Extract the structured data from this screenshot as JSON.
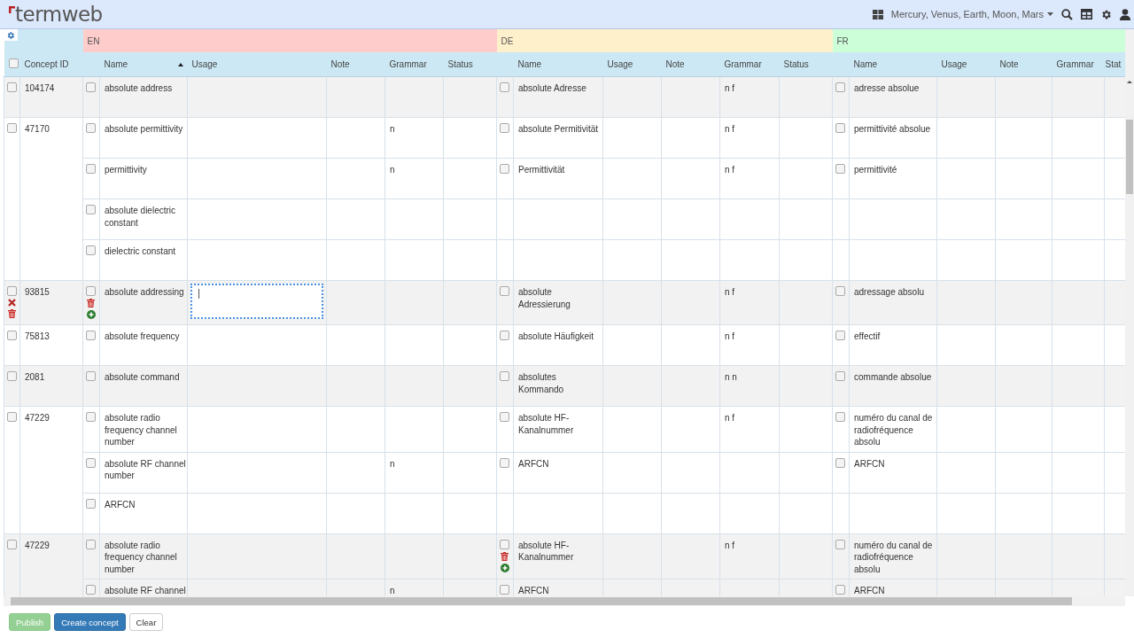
{
  "header": {
    "logo": "termweb",
    "project_selector": "Mercury, Venus, Earth, Moon, Mars"
  },
  "table": {
    "select_all": {
      "checked": false
    },
    "concept_column": "Concept ID",
    "languages": [
      {
        "code": "EN",
        "color": "#ffcccc",
        "columns": [
          {
            "label": "Name",
            "sorted": true
          },
          {
            "label": "Usage",
            "sorted": false
          },
          {
            "label": "Note",
            "sorted": false
          },
          {
            "label": "Grammar",
            "sorted": false
          },
          {
            "label": "Status",
            "sorted": false
          }
        ]
      },
      {
        "code": "DE",
        "color": "#fff0cc",
        "columns": [
          {
            "label": "Name",
            "sorted": false
          },
          {
            "label": "Usage",
            "sorted": false
          },
          {
            "label": "Note",
            "sorted": false
          },
          {
            "label": "Grammar",
            "sorted": false
          },
          {
            "label": "Status",
            "sorted": false
          }
        ]
      },
      {
        "code": "FR",
        "color": "#ccffd8",
        "columns": [
          {
            "label": "Name",
            "sorted": false
          },
          {
            "label": "Usage",
            "sorted": false
          },
          {
            "label": "Note",
            "sorted": false
          },
          {
            "label": "Grammar",
            "sorted": false
          },
          {
            "label": "Stat",
            "sorted": false
          }
        ]
      }
    ],
    "concepts": [
      {
        "id": "104174",
        "checked": false,
        "terms": [
          {
            "en": {
              "name": "absolute address",
              "checked": false
            },
            "de": {
              "name": "absolute Adresse",
              "grammar": "n f",
              "checked": false
            },
            "fr": {
              "name": "adresse absolue",
              "checked": false
            }
          }
        ]
      },
      {
        "id": "47170",
        "checked": false,
        "terms": [
          {
            "en": {
              "name": "absolute permittivity",
              "grammar": "n",
              "checked": false
            },
            "de": {
              "name": "absolute Permitivität",
              "grammar": "n f",
              "checked": false
            },
            "fr": {
              "name": "permittivité absolue",
              "checked": false
            }
          },
          {
            "en": {
              "name": "permittivity",
              "grammar": "n",
              "checked": false
            },
            "de": {
              "name": "Permittivität",
              "grammar": "n f",
              "checked": false
            },
            "fr": {
              "name": "permittivité",
              "checked": false
            }
          },
          {
            "en": {
              "name": "absolute dielectric constant",
              "checked": false
            }
          },
          {
            "en": {
              "name": "dielectric constant",
              "checked": false
            }
          }
        ]
      },
      {
        "id": "93815",
        "checked": false,
        "actions": true,
        "terms": [
          {
            "en": {
              "name": "absolute addressing",
              "checked": false,
              "actions": true,
              "usage_editing": true
            },
            "de": {
              "name": "absolute Adressierung",
              "grammar": "n f",
              "checked": false
            },
            "fr": {
              "name": "adressage absolu",
              "checked": false
            }
          }
        ]
      },
      {
        "id": "75813",
        "checked": false,
        "terms": [
          {
            "en": {
              "name": "absolute frequency",
              "checked": false
            },
            "de": {
              "name": "absolute Häufigkeit",
              "grammar": "n f",
              "checked": false
            },
            "fr": {
              "name": "effectif",
              "checked": false
            }
          }
        ]
      },
      {
        "id": "2081",
        "checked": false,
        "terms": [
          {
            "en": {
              "name": "absolute command",
              "checked": false
            },
            "de": {
              "name": "absolutes Kommando",
              "grammar": "n n",
              "checked": false
            },
            "fr": {
              "name": "commande absolue",
              "checked": false
            }
          }
        ]
      },
      {
        "id": "47229",
        "checked": false,
        "terms": [
          {
            "en": {
              "name": "absolute radio frequency channel number",
              "checked": false
            },
            "de": {
              "name": "absolute HF-Kanalnummer",
              "grammar": "n f",
              "checked": false
            },
            "fr": {
              "name": "numéro du canal de radiofréquence absolu",
              "checked": false
            }
          },
          {
            "en": {
              "name": "absolute RF channel number",
              "grammar": "n",
              "checked": false
            },
            "de": {
              "name": "ARFCN",
              "checked": false
            },
            "fr": {
              "name": "ARFCN",
              "checked": false
            }
          },
          {
            "en": {
              "name": "ARFCN",
              "checked": false
            }
          }
        ]
      },
      {
        "id": "47229",
        "checked": false,
        "terms": [
          {
            "en": {
              "name": "absolute radio frequency channel number",
              "checked": false
            },
            "de": {
              "name": "absolute HF-Kanalnummer",
              "grammar": "n f",
              "checked": false,
              "actions": true
            },
            "fr": {
              "name": "numéro du canal de radiofréquence absolu",
              "checked": false
            }
          },
          {
            "en": {
              "name": "absolute RF channel",
              "grammar": "n",
              "checked": false
            },
            "de": {
              "name": "ARFCN",
              "checked": false
            },
            "fr": {
              "name": "ARFCN",
              "checked": false
            }
          }
        ]
      }
    ]
  },
  "footer": {
    "buttons": [
      {
        "label": "Publish",
        "kind": "success",
        "disabled": true
      },
      {
        "label": "Create concept",
        "kind": "primary",
        "disabled": false
      },
      {
        "label": "Clear",
        "kind": "default",
        "disabled": false
      }
    ]
  }
}
